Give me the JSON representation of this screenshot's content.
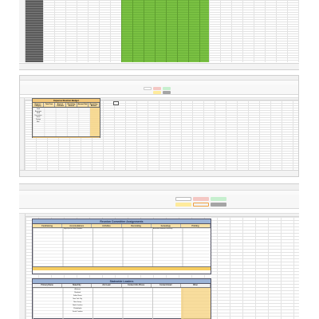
{
  "budget_table": {
    "title": "Expense Reunion Budget",
    "columns": [
      "Expense Category",
      "Total Cost",
      "Amount Collected",
      "Remaining Amount",
      "Amount Paid",
      "Remaining Balance"
    ],
    "items": [
      "Food",
      "Beverages",
      "Shirts",
      "Decorations",
      "Venue",
      "Postage",
      "Misc."
    ]
  },
  "reunion_table": {
    "title": "Reunion Committee Assignments",
    "columns": [
      "Fundraising",
      "Accomodations",
      "Activities",
      "Decorating",
      "Genealogy",
      "Printing"
    ],
    "notes": [
      "Sign-Ups for Other Vendors",
      "Assemble Historian Directory"
    ]
  },
  "leaders_table": {
    "title": "Statewide Leaders",
    "columns": [
      "Primary Name",
      "State/City",
      "2nd Lead",
      "Contact Info Phone",
      "Contact Email",
      "Other"
    ],
    "states": [
      "Alabama",
      "Maryland",
      "Dallas/Texas",
      "New York City",
      "New Jersey",
      "North Carolina",
      "Philadelphia",
      "South Carolina"
    ]
  },
  "ribbon_styles": {
    "labels": [
      "Normal",
      "Bad",
      "Good",
      "Neutral",
      "Calculation",
      "Check Cell"
    ],
    "colors": [
      "#ffffff",
      "#f4c7c3",
      "#c6efce",
      "#ffeb9c",
      "#f2f2f2",
      "#a5a5a5"
    ]
  },
  "colors": {
    "green_block": "#7ac142",
    "title_blue": "#9bb3d6",
    "header_gold": "#f7e2a8",
    "highlight_gold": "#f6cd61"
  }
}
